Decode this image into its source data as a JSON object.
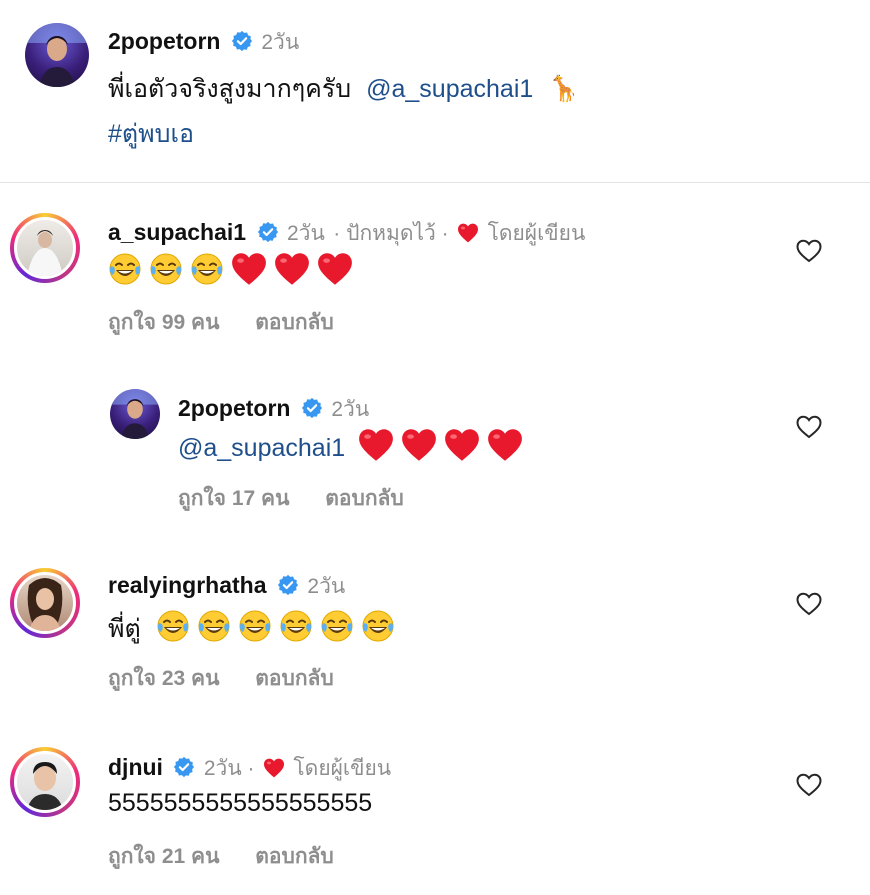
{
  "caption": {
    "username": "2popetorn",
    "time": "2วัน",
    "text": "พี่เอตัวจริงสูงมากๆครับ",
    "mention": "@a_supachai1",
    "emoji": "🦒",
    "hashtag": "#ตู่พบเอ"
  },
  "comments": [
    {
      "username": "a_supachai1",
      "time": "2วัน",
      "pinned": "· ปักหมุดไว้ ·",
      "liked_by_author": "โดยผู้เขียน",
      "emojis": [
        "laugh",
        "laugh",
        "laugh",
        "heart",
        "heart",
        "heart"
      ],
      "likes": "ถูกใจ 99 คน",
      "reply": "ตอบกลับ"
    },
    {
      "username": "2popetorn",
      "time": "2วัน",
      "mention": "@a_supachai1",
      "emojis": [
        "heart",
        "heart",
        "heart",
        "heart"
      ],
      "likes": "ถูกใจ 17 คน",
      "reply": "ตอบกลับ"
    },
    {
      "username": "realyingrhatha",
      "time": "2วัน",
      "text": "พี่ตู่",
      "emojis": [
        "laugh",
        "laugh",
        "laugh",
        "laugh",
        "laugh",
        "laugh"
      ],
      "likes": "ถูกใจ 23 คน",
      "reply": "ตอบกลับ"
    },
    {
      "username": "djnui",
      "time": "2วัน ·",
      "liked_by_author": "โดยผู้เขียน",
      "text": "5555555555555555555",
      "likes": "ถูกใจ 21 คน",
      "reply": "ตอบกลับ"
    }
  ],
  "icons": {
    "verified": "verified-badge-icon",
    "like": "heart-outline-icon",
    "laugh": "tears-of-joy-emoji",
    "heart": "red-heart-emoji"
  },
  "colors": {
    "verified": "#3897f0",
    "mention": "#1f4f8b",
    "heart": "#e8192c",
    "meta": "#8e8e8e"
  }
}
